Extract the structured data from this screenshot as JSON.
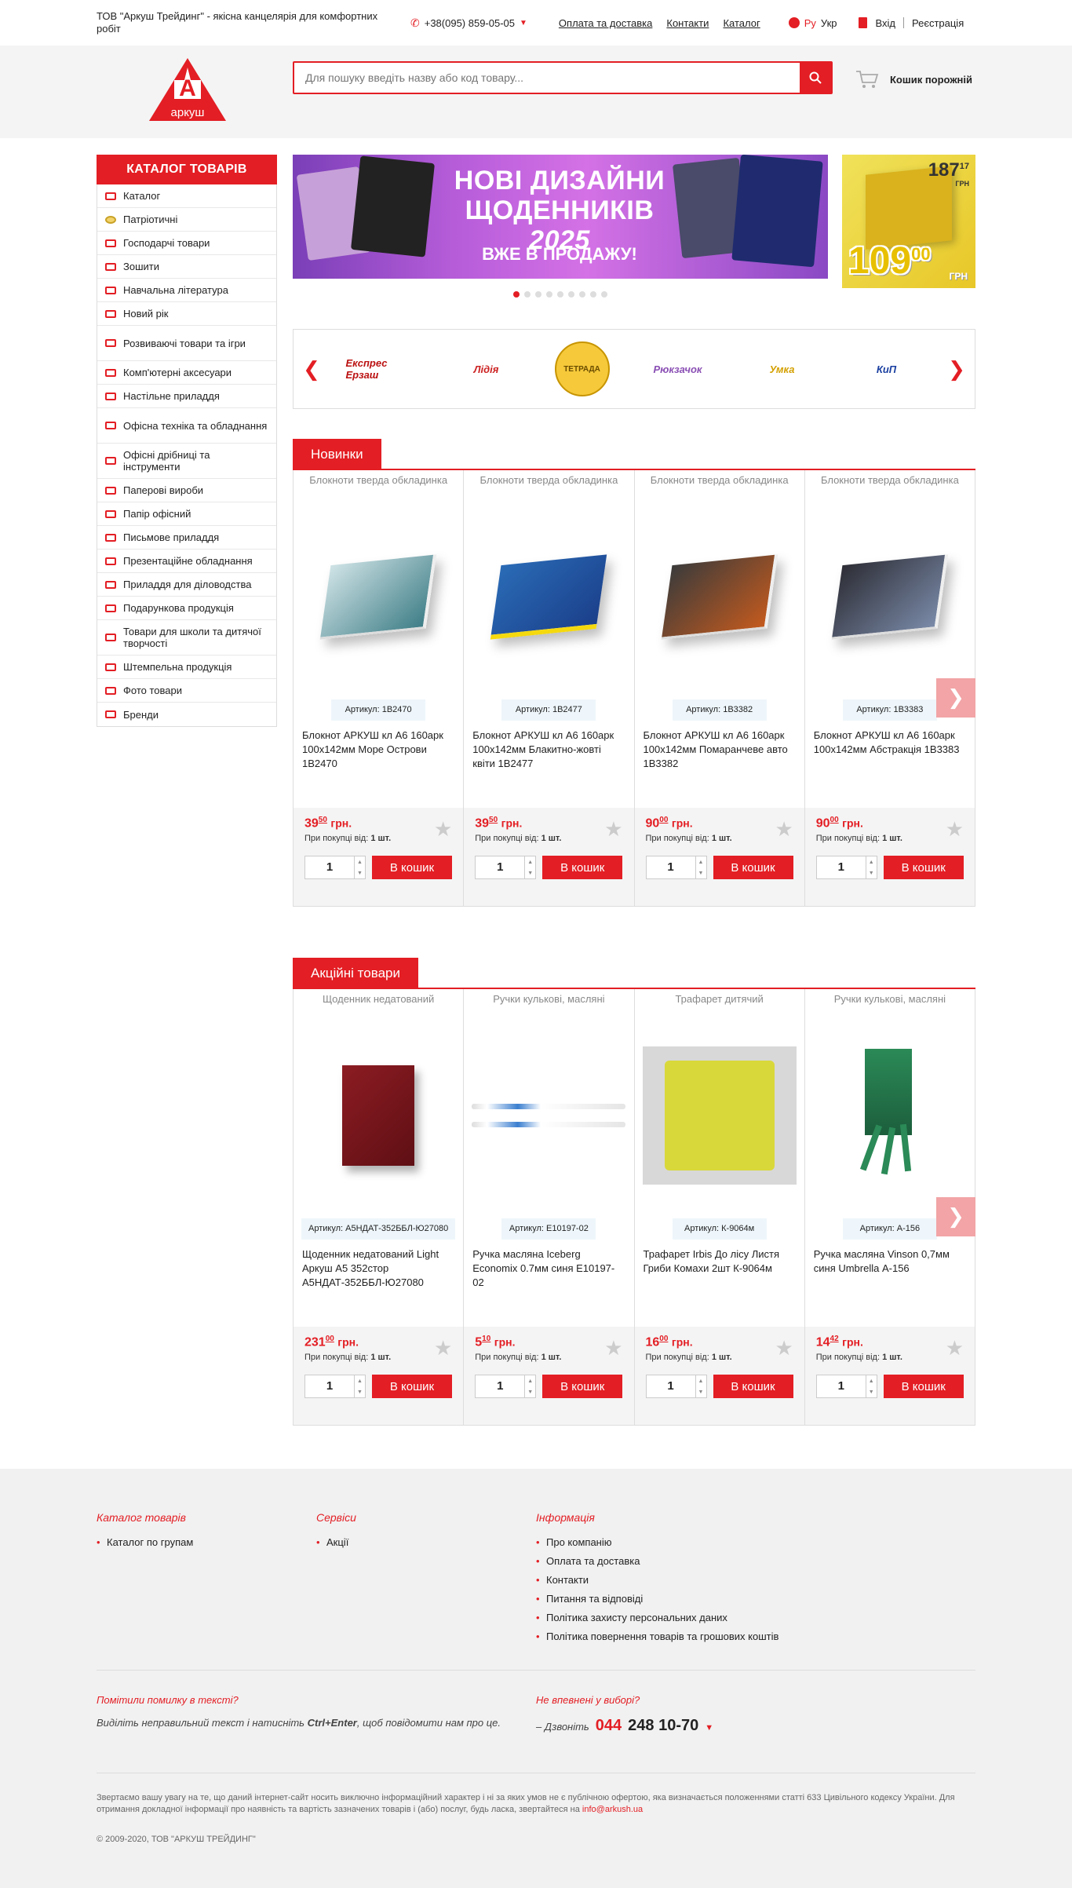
{
  "topbar": {
    "company": "ТОВ \"Аркуш Трейдинг\" - якісна канцелярія для комфортних робіт",
    "phone": "+38(095) 859-05-05",
    "links": [
      "Оплата та доставка",
      "Контакти",
      "Каталог"
    ],
    "lang_ru": "Ру",
    "lang_ukr": "Укр",
    "login": "Вхід",
    "register": "Реєстрація"
  },
  "header": {
    "logo_text": "аркуш",
    "search_placeholder": "Для пошуку введіть назву або код товару...",
    "cart_label": "Кошик порожній"
  },
  "sidebar": {
    "title": "КАТАЛОГ ТОВАРІВ",
    "items": [
      "Каталог",
      "Патріотичні",
      "Господарчі товари",
      "Зошити",
      "Навчальна література",
      "Новий рік",
      "Розвиваючі товари та ігри",
      "Комп'ютерні аксесуари",
      "Настільне приладдя",
      "Офісна техніка та обладнання",
      "Офісні дрібниці та інструменти",
      "Паперові вироби",
      "Папір офісний",
      "Письмове приладдя",
      "Презентаційне обладнання",
      "Приладдя для діловодства",
      "Подарункова продукція",
      "Товари для школи та дитячої творчості",
      "Штемпельна продукція",
      "Фото товари",
      "Бренди"
    ]
  },
  "banner": {
    "line1": "НОВІ ДИЗАЙНИ",
    "line2": "ЩОДЕННИКІВ",
    "year": "2025",
    "line3": "ВЖЕ В ПРОДАЖУ!",
    "dots": 9,
    "active_dot": 0
  },
  "promo": {
    "old_price": "187",
    "old_cents": "17",
    "old_cur": "ГРН",
    "new_price": "109",
    "new_cents": "00",
    "new_cur": "ГРН"
  },
  "brands": [
    {
      "name": "Експрес Ерзаш",
      "color": "#b11"
    },
    {
      "name": "Лідія",
      "color": "#c22"
    },
    {
      "name": "ТЕТРАДА",
      "color": "#c79400"
    },
    {
      "name": "Рюкзачок",
      "color": "#8a4fb4"
    },
    {
      "name": "Умка",
      "color": "#d4a000"
    },
    {
      "name": "КиП",
      "color": "#1a3fa0"
    }
  ],
  "new_section": {
    "title": "Новинки",
    "products": [
      {
        "category": "Блокноти тверда обкладинка",
        "sku": "Артикул: 1B2470",
        "name": "Блокнот АРКУШ кл А6 160арк 100x142мм Море Острови 1B2470",
        "price": "39",
        "cents": "50",
        "cur": "грн.",
        "min_label": "При покупці від:",
        "min_value": "1 шт.",
        "qty": "1",
        "button": "В кошик",
        "img": "sea"
      },
      {
        "category": "Блокноти тверда обкладинка",
        "sku": "Артикул: 1B2477",
        "name": "Блокнот АРКУШ кл А6 160арк 100x142мм Блакитно-жовті квіти 1B2477",
        "price": "39",
        "cents": "50",
        "cur": "грн.",
        "min_label": "При покупці від:",
        "min_value": "1 шт.",
        "qty": "1",
        "button": "В кошик",
        "img": "blue"
      },
      {
        "category": "Блокноти тверда обкладинка",
        "sku": "Артикул: 1B3382",
        "name": "Блокнот АРКУШ кл А6 160арк 100x142мм Помаранчеве авто 1B3382",
        "price": "90",
        "cents": "00",
        "cur": "грн.",
        "min_label": "При покупці від:",
        "min_value": "1 шт.",
        "qty": "1",
        "button": "В кошик",
        "img": "car"
      },
      {
        "category": "Блокноти тверда обкладинка",
        "sku": "Артикул: 1B3383",
        "name": "Блокнот АРКУШ кл А6 160арк 100x142мм Абстракція 1B3383",
        "price": "90",
        "cents": "00",
        "cur": "грн.",
        "min_label": "При покупці від:",
        "min_value": "1 шт.",
        "qty": "1",
        "button": "В кошик",
        "img": "abstract"
      }
    ]
  },
  "sale_section": {
    "title": "Акційні товари",
    "products": [
      {
        "category": "Щоденник недатований",
        "sku": "Артикул: А5НДАТ-352ББЛ-Ю27080",
        "name": "Щоденник недатований Light Аркуш А5 352стор А5НДАТ-352ББЛ-Ю27080",
        "price": "231",
        "cents": "00",
        "cur": "грн.",
        "min_label": "При покупці від:",
        "min_value": "1 шт.",
        "qty": "1",
        "button": "В кошик",
        "img": "diary"
      },
      {
        "category": "Ручки кулькові, масляні",
        "sku": "Артикул: E10197-02",
        "name": "Ручка масляна Iceberg Economix 0.7мм синя E10197-02",
        "price": "5",
        "cents": "10",
        "cur": "грн.",
        "min_label": "При покупці від:",
        "min_value": "1 шт.",
        "qty": "1",
        "button": "В кошик",
        "img": "pens"
      },
      {
        "category": "Трафарет дитячий",
        "sku": "Артикул: К-9064м",
        "name": "Трафарет Irbis До лісу Листя Гриби Комахи 2шт К-9064м",
        "price": "16",
        "cents": "00",
        "cur": "грн.",
        "min_label": "При покупці від:",
        "min_value": "1 шт.",
        "qty": "1",
        "button": "В кошик",
        "img": "stencil"
      },
      {
        "category": "Ручки кулькові, масляні",
        "sku": "Артикул: А-156",
        "name": "Ручка масляна Vinson 0,7мм синя Umbrella А-156",
        "price": "14",
        "cents": "42",
        "cur": "грн.",
        "min_label": "При покупці від:",
        "min_value": "1 шт.",
        "qty": "1",
        "button": "В кошик",
        "img": "display"
      }
    ]
  },
  "footer": {
    "col1_title": "Каталог товарів",
    "col1_items": [
      "Каталог по групам"
    ],
    "col2_title": "Сервіси",
    "col2_items": [
      "Акції"
    ],
    "col3_title": "Інформація",
    "col3_items": [
      "Про компанію",
      "Оплата та доставка",
      "Контакти",
      "Питання та відповіді",
      "Політика захисту персональних даних",
      "Політика повернення товарів та грошових коштів"
    ],
    "error_q": "Помітили помилку в тексті?",
    "error_note_pre": "Виділіть неправильний текст і натисніть",
    "error_note_keys": "Ctrl+Enter",
    "error_note_post": ", щоб повідомити нам про це.",
    "choice_q": "Не впевнені у виборі?",
    "call_label": "– Дзвоніть",
    "call_code": "044",
    "call_number": "248 10-70",
    "disclaimer": "Звертаємо вашу увагу на те, що даний інтернет-сайт носить виключно інформаційний характер і ні за яких умов не є публічною офертою, яка визначається положеннями статті 633 Цивільного кодексу України. Для отримання докладної інформації про наявність та вартість зазначених товарів і (або) послуг, будь ласка, звертайтеся на",
    "email": "info@arkush.ua",
    "copyright": "© 2009-2020, ТОВ \"АРКУШ ТРЕЙДИНГ\""
  }
}
